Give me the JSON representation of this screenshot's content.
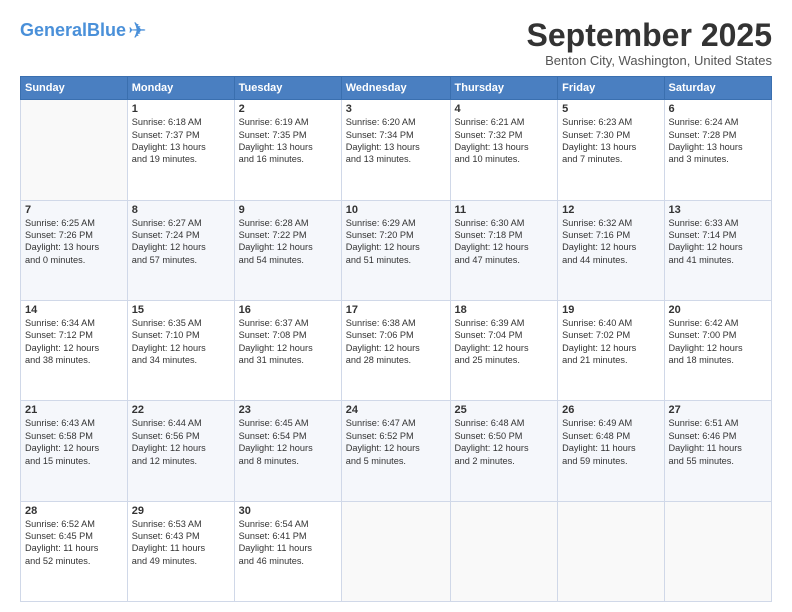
{
  "header": {
    "logo_general": "General",
    "logo_blue": "Blue",
    "month_title": "September 2025",
    "location": "Benton City, Washington, United States"
  },
  "days_of_week": [
    "Sunday",
    "Monday",
    "Tuesday",
    "Wednesday",
    "Thursday",
    "Friday",
    "Saturday"
  ],
  "weeks": [
    [
      {
        "day": "",
        "detail": ""
      },
      {
        "day": "1",
        "detail": "Sunrise: 6:18 AM\nSunset: 7:37 PM\nDaylight: 13 hours\nand 19 minutes."
      },
      {
        "day": "2",
        "detail": "Sunrise: 6:19 AM\nSunset: 7:35 PM\nDaylight: 13 hours\nand 16 minutes."
      },
      {
        "day": "3",
        "detail": "Sunrise: 6:20 AM\nSunset: 7:34 PM\nDaylight: 13 hours\nand 13 minutes."
      },
      {
        "day": "4",
        "detail": "Sunrise: 6:21 AM\nSunset: 7:32 PM\nDaylight: 13 hours\nand 10 minutes."
      },
      {
        "day": "5",
        "detail": "Sunrise: 6:23 AM\nSunset: 7:30 PM\nDaylight: 13 hours\nand 7 minutes."
      },
      {
        "day": "6",
        "detail": "Sunrise: 6:24 AM\nSunset: 7:28 PM\nDaylight: 13 hours\nand 3 minutes."
      }
    ],
    [
      {
        "day": "7",
        "detail": "Sunrise: 6:25 AM\nSunset: 7:26 PM\nDaylight: 13 hours\nand 0 minutes."
      },
      {
        "day": "8",
        "detail": "Sunrise: 6:27 AM\nSunset: 7:24 PM\nDaylight: 12 hours\nand 57 minutes."
      },
      {
        "day": "9",
        "detail": "Sunrise: 6:28 AM\nSunset: 7:22 PM\nDaylight: 12 hours\nand 54 minutes."
      },
      {
        "day": "10",
        "detail": "Sunrise: 6:29 AM\nSunset: 7:20 PM\nDaylight: 12 hours\nand 51 minutes."
      },
      {
        "day": "11",
        "detail": "Sunrise: 6:30 AM\nSunset: 7:18 PM\nDaylight: 12 hours\nand 47 minutes."
      },
      {
        "day": "12",
        "detail": "Sunrise: 6:32 AM\nSunset: 7:16 PM\nDaylight: 12 hours\nand 44 minutes."
      },
      {
        "day": "13",
        "detail": "Sunrise: 6:33 AM\nSunset: 7:14 PM\nDaylight: 12 hours\nand 41 minutes."
      }
    ],
    [
      {
        "day": "14",
        "detail": "Sunrise: 6:34 AM\nSunset: 7:12 PM\nDaylight: 12 hours\nand 38 minutes."
      },
      {
        "day": "15",
        "detail": "Sunrise: 6:35 AM\nSunset: 7:10 PM\nDaylight: 12 hours\nand 34 minutes."
      },
      {
        "day": "16",
        "detail": "Sunrise: 6:37 AM\nSunset: 7:08 PM\nDaylight: 12 hours\nand 31 minutes."
      },
      {
        "day": "17",
        "detail": "Sunrise: 6:38 AM\nSunset: 7:06 PM\nDaylight: 12 hours\nand 28 minutes."
      },
      {
        "day": "18",
        "detail": "Sunrise: 6:39 AM\nSunset: 7:04 PM\nDaylight: 12 hours\nand 25 minutes."
      },
      {
        "day": "19",
        "detail": "Sunrise: 6:40 AM\nSunset: 7:02 PM\nDaylight: 12 hours\nand 21 minutes."
      },
      {
        "day": "20",
        "detail": "Sunrise: 6:42 AM\nSunset: 7:00 PM\nDaylight: 12 hours\nand 18 minutes."
      }
    ],
    [
      {
        "day": "21",
        "detail": "Sunrise: 6:43 AM\nSunset: 6:58 PM\nDaylight: 12 hours\nand 15 minutes."
      },
      {
        "day": "22",
        "detail": "Sunrise: 6:44 AM\nSunset: 6:56 PM\nDaylight: 12 hours\nand 12 minutes."
      },
      {
        "day": "23",
        "detail": "Sunrise: 6:45 AM\nSunset: 6:54 PM\nDaylight: 12 hours\nand 8 minutes."
      },
      {
        "day": "24",
        "detail": "Sunrise: 6:47 AM\nSunset: 6:52 PM\nDaylight: 12 hours\nand 5 minutes."
      },
      {
        "day": "25",
        "detail": "Sunrise: 6:48 AM\nSunset: 6:50 PM\nDaylight: 12 hours\nand 2 minutes."
      },
      {
        "day": "26",
        "detail": "Sunrise: 6:49 AM\nSunset: 6:48 PM\nDaylight: 11 hours\nand 59 minutes."
      },
      {
        "day": "27",
        "detail": "Sunrise: 6:51 AM\nSunset: 6:46 PM\nDaylight: 11 hours\nand 55 minutes."
      }
    ],
    [
      {
        "day": "28",
        "detail": "Sunrise: 6:52 AM\nSunset: 6:45 PM\nDaylight: 11 hours\nand 52 minutes."
      },
      {
        "day": "29",
        "detail": "Sunrise: 6:53 AM\nSunset: 6:43 PM\nDaylight: 11 hours\nand 49 minutes."
      },
      {
        "day": "30",
        "detail": "Sunrise: 6:54 AM\nSunset: 6:41 PM\nDaylight: 11 hours\nand 46 minutes."
      },
      {
        "day": "",
        "detail": ""
      },
      {
        "day": "",
        "detail": ""
      },
      {
        "day": "",
        "detail": ""
      },
      {
        "day": "",
        "detail": ""
      }
    ]
  ]
}
